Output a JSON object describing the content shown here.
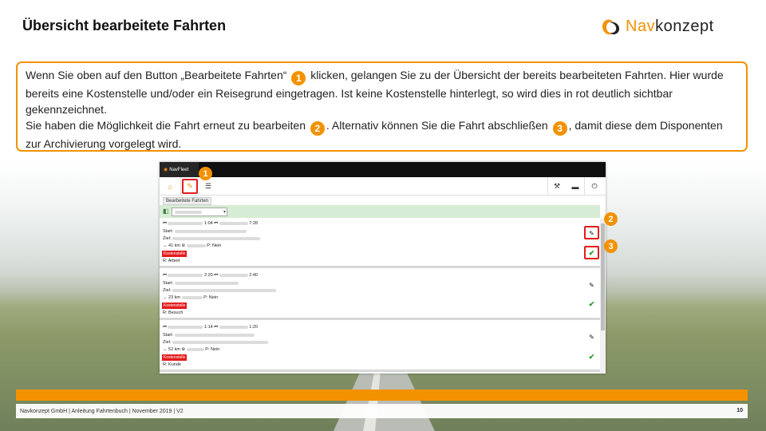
{
  "slide": {
    "title": "Übersicht bearbeitete Fahrten",
    "logo": {
      "prefix": "Nav",
      "suffix": "konzept"
    }
  },
  "info": {
    "p1_a": "Wenn Sie oben auf den Button „Bearbeitete Fahrten“",
    "badge1": "1",
    "p1_b": "klicken, gelangen Sie zu der Übersicht der bereits bearbeiteten Fahrten. Hier wurde bereits eine Kostenstelle und/oder ein Reisegrund eingetragen. Ist keine Kostenstelle hinterlegt, so wird dies in rot deutlich sichtbar gekennzeichnet.",
    "p2_a": "Sie haben die Möglichkeit die Fahrt erneut zu bearbeiten",
    "badge2": "2",
    "p2_b": ". Alternativ können Sie die Fahrt abschließen",
    "badge3": "3",
    "p2_c": ", damit diese dem Disponenten zur Archivierung vorgelegt wird."
  },
  "app": {
    "tab_prefix": "Nav",
    "tab_suffix": "Fleet",
    "icons": {
      "home": "home-icon",
      "edit": "edit-trips-icon",
      "list": "list-icon",
      "tool": "wrench-icon",
      "device": "device-icon",
      "power": "power-icon"
    },
    "breadcrumb": "Bearbeitete Fahrten",
    "rows": [
      {
        "time_start": "1:04",
        "time_end": "7:28",
        "start_label": "Start:",
        "ziel_label": "Ziel:",
        "dist": "↔ 41 km",
        "pnr": "P: Nein",
        "ks": "Kostenstelle",
        "reason": "R: Arbeit"
      },
      {
        "time_start": "2:20",
        "time_end": "2:40",
        "start_label": "Start:",
        "ziel_label": "Ziel:",
        "dist": "↔ 23 km",
        "pnr": "P: Nein",
        "ks": "Kostenstelle",
        "reason": "R: Besuch"
      },
      {
        "time_start": "1:14",
        "time_end": "1:20",
        "start_label": "Start:",
        "ziel_label": "Ziel:",
        "dist": "↔ 52 km",
        "pnr": "P: Nein",
        "ks": "Kostenstelle",
        "reason": "R: Kunde"
      }
    ],
    "callouts": {
      "c1": "1",
      "c2": "2",
      "c3": "3"
    }
  },
  "footer": {
    "text": "Navkonzept GmbH  |  Anleitung Fahrtenbuch  |  November 2019  |  V2",
    "page": "10"
  },
  "colors": {
    "accent": "#f39200",
    "alert": "#e41b1b",
    "confirm": "#2b9a2b"
  }
}
